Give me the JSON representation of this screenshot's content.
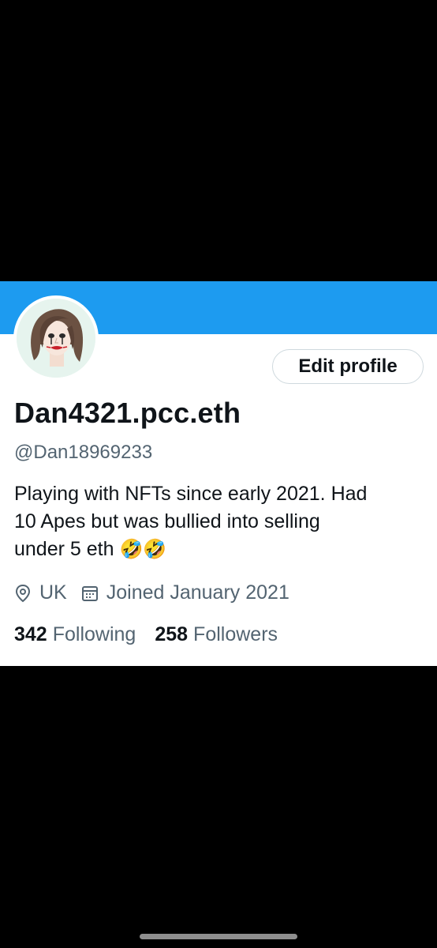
{
  "profile": {
    "edit_button": "Edit profile",
    "display_name": "Dan4321.pcc.eth",
    "handle": "@Dan18969233",
    "bio_line1": "Playing with NFTs since early 2021. Had",
    "bio_line2": "10 Apes but was bullied into selling",
    "bio_line3": "under 5 eth",
    "bio_emoji": "🤣🤣",
    "location": "UK",
    "joined": "Joined January 2021",
    "following_count": "342",
    "following_label": "Following",
    "followers_count": "258",
    "followers_label": "Followers"
  },
  "icons": {
    "location": "location-pin-icon",
    "calendar": "calendar-icon"
  },
  "colors": {
    "banner": "#1d9bf0",
    "text_primary": "#0f1419",
    "text_secondary": "#536471",
    "border": "#cfd9de"
  }
}
